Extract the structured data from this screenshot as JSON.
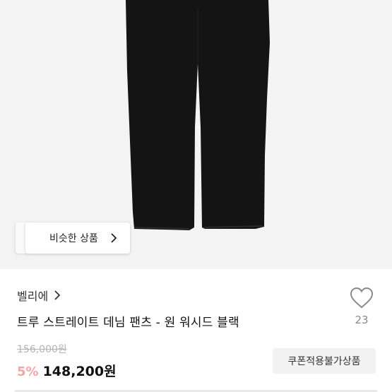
{
  "product_image": {
    "alt": "black straight denim pants",
    "similar_button_label": "비슷한 상품"
  },
  "seller": {
    "name": "벨리에"
  },
  "product": {
    "title": "트루 스트레이트 데님 팬츠 - 원 워시드 블랙",
    "original_price": "156,000원",
    "discount": "5%",
    "price": "148,200원",
    "badge": "쿠폰적용불가상품"
  },
  "like": {
    "count": "23"
  },
  "colors": {
    "discount": "#f3a7a7",
    "image_bg": "#f3f3f3",
    "badge_bg": "#f2f2f2"
  }
}
